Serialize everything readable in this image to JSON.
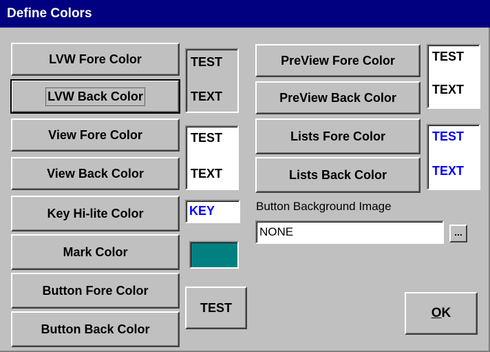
{
  "window": {
    "title": "Define Colors"
  },
  "colors": {
    "title_bg": "#000080",
    "face": "#c0c0c0",
    "sample_blue": "#0000ff",
    "mark": "#008080"
  },
  "left_buttons": {
    "lvw_fore": "LVW Fore Color",
    "lvw_back": "LVW Back Color",
    "view_fore": "View Fore Color",
    "view_back": "View Back Color",
    "key_hilite": "Key Hi-lite Color",
    "mark": "Mark Color",
    "button_fore": "Button Fore Color",
    "button_back": "Button Back Color"
  },
  "right_buttons": {
    "preview_fore": "PreView Fore Color",
    "preview_back": "PreView Back Color",
    "lists_fore": "Lists Fore Color",
    "lists_back": "Lists Back Color"
  },
  "samples": {
    "lvw": {
      "line1": "TEST",
      "line2": "TEXT"
    },
    "view": {
      "line1": "TEST",
      "line2": "TEXT"
    },
    "preview": {
      "line1": "TEST",
      "line2": "TEXT"
    },
    "lists": {
      "line1": "TEST",
      "line2": "TEXT"
    },
    "key": "KEY",
    "button": "TEST"
  },
  "background_image": {
    "label": "Button Background Image",
    "value": "NONE",
    "browse_label": "..."
  },
  "ok_button": {
    "label_prefix": "O",
    "label_rest": "K"
  }
}
